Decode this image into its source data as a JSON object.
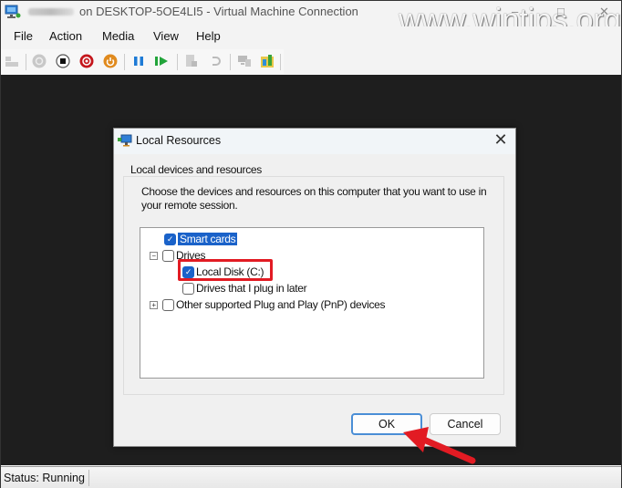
{
  "window": {
    "title": "on DESKTOP-5OE4LI5 - Virtual Machine Connection",
    "watermark": "www.wintips.org",
    "minimize_glyph": "–",
    "maximize_glyph": "□",
    "close_glyph": "✕"
  },
  "menu": {
    "items": [
      "File",
      "Action",
      "Media",
      "View",
      "Help"
    ]
  },
  "toolbar": {
    "buttons": [
      {
        "icon": "ctrl-alt-del-icon",
        "enabled": false
      },
      {
        "icon": "start-icon",
        "enabled": false
      },
      {
        "icon": "turn-off-icon",
        "enabled": true
      },
      {
        "icon": "shut-down-icon",
        "enabled": true
      },
      {
        "icon": "save-icon",
        "enabled": true
      },
      {
        "icon": "pause-icon",
        "enabled": true
      },
      {
        "icon": "reset-icon",
        "enabled": true
      },
      {
        "icon": "checkpoint-icon",
        "enabled": false
      },
      {
        "icon": "revert-icon",
        "enabled": false
      },
      {
        "icon": "enhanced-session-icon",
        "enabled": false
      },
      {
        "icon": "share-icon",
        "enabled": true
      }
    ]
  },
  "status": {
    "text": "Status: Running"
  },
  "dialog": {
    "title": "Local Resources",
    "close_glyph": "✕",
    "group_label": "Local devices and resources",
    "description": "Choose the devices and resources on this computer that you want to use in your remote session.",
    "tree": [
      {
        "label": "Smart cards",
        "checked": true,
        "selected": true,
        "level": 0,
        "expander": null
      },
      {
        "label": "Drives",
        "checked": false,
        "selected": false,
        "level": 0,
        "expander": "collapse"
      },
      {
        "label": "Local Disk (C:)",
        "checked": true,
        "selected": false,
        "level": 1,
        "expander": null,
        "highlighted": true
      },
      {
        "label": "Drives that I plug in later",
        "checked": false,
        "selected": false,
        "level": 1,
        "expander": null
      },
      {
        "label": "Other supported Plug and Play (PnP) devices",
        "checked": false,
        "selected": false,
        "level": 0,
        "expander": "expand"
      }
    ],
    "ok_label": "OK",
    "cancel_label": "Cancel"
  },
  "colors": {
    "accent": "#1a62c9",
    "highlight": "#e21b23",
    "vm_background": "#1e1e1e"
  }
}
